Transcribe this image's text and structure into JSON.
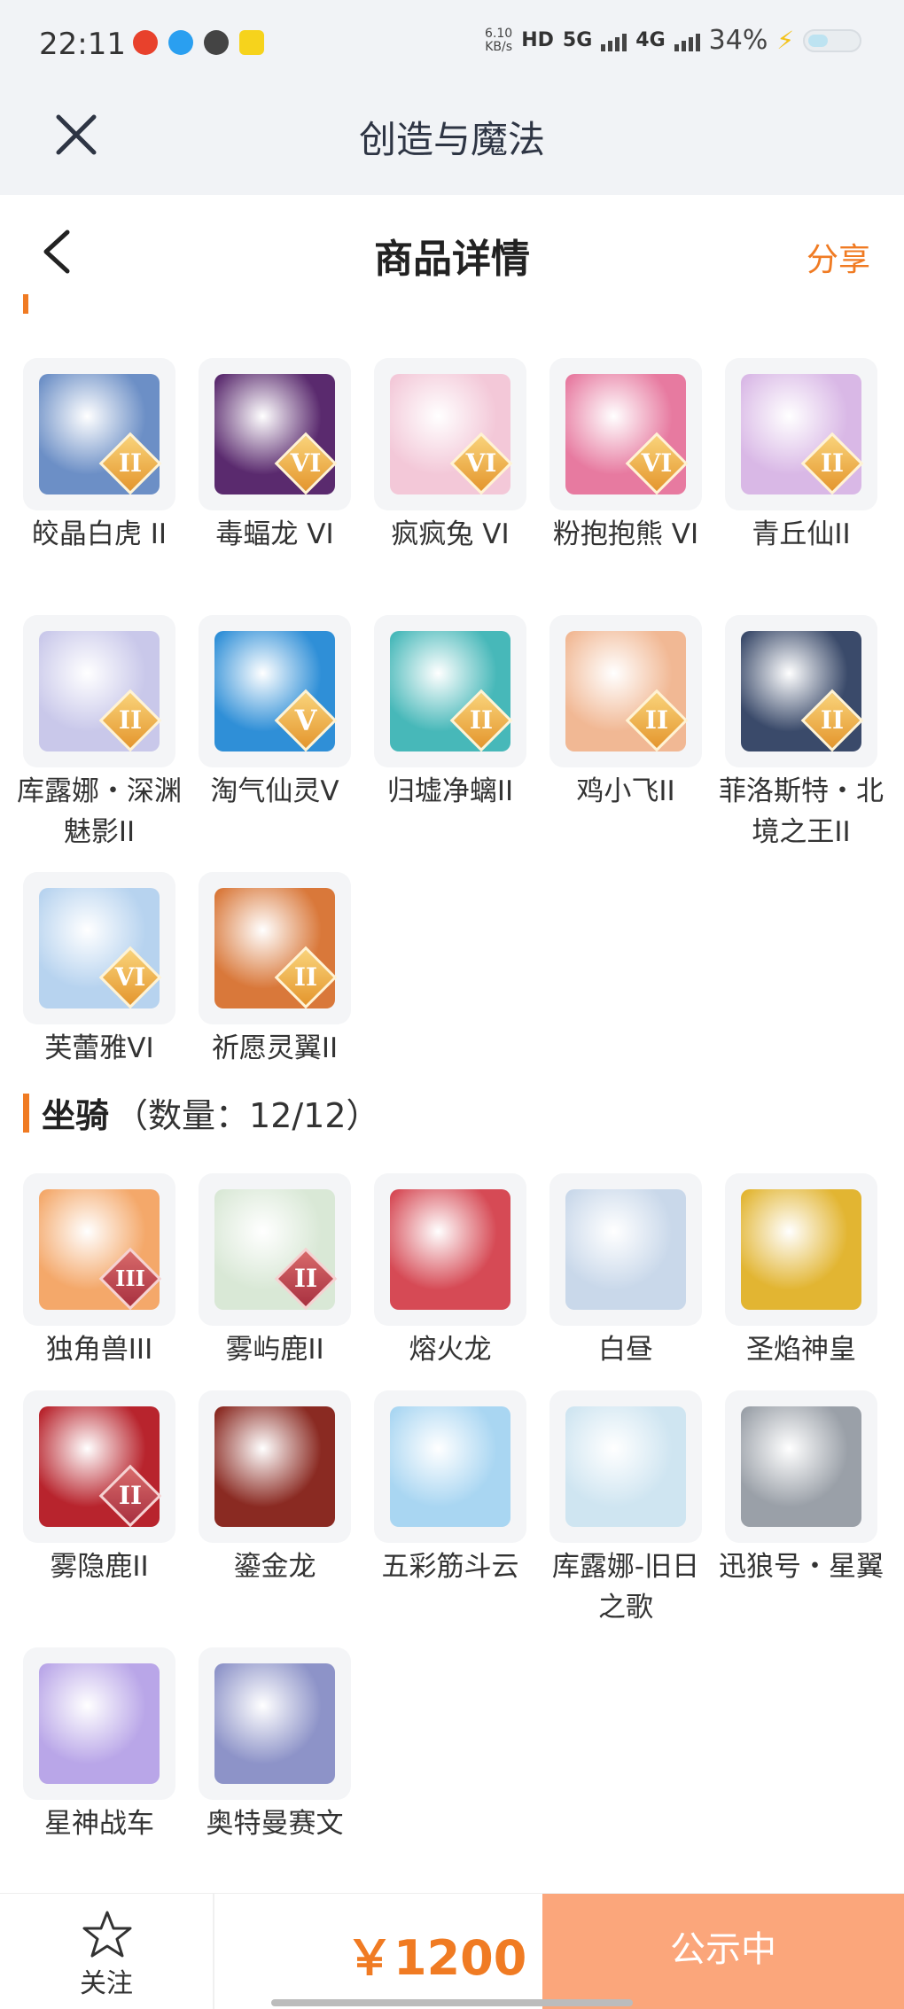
{
  "status_bar": {
    "time": "22:11",
    "net_speed_value": "6.10",
    "net_speed_unit": "KB/s",
    "hd": "HD",
    "sim1": "5G",
    "sim2": "4G",
    "battery": "34%"
  },
  "app_header": {
    "title": "创造与魔法"
  },
  "page_header": {
    "title": "商品详情",
    "share_label": "分享"
  },
  "pets_section": {
    "items": [
      {
        "name": "皎晶白虎 II",
        "rank": "II",
        "color": "#6c8fc6"
      },
      {
        "name": "毒蝠龙 VI",
        "rank": "VI",
        "color": "#5a2a6e"
      },
      {
        "name": "疯疯兔 VI",
        "rank": "VI",
        "color": "#f3c8d8"
      },
      {
        "name": "粉抱抱熊 VI",
        "rank": "VI",
        "color": "#e77aa0"
      },
      {
        "name": "青丘仙II",
        "rank": "II",
        "color": "#d9b8e6"
      },
      {
        "name": "库露娜・深渊魅影II",
        "rank": "II",
        "color": "#c9c8ea"
      },
      {
        "name": "淘气仙灵V",
        "rank": "V",
        "color": "#2f8fd7"
      },
      {
        "name": "归墟净螭II",
        "rank": "II",
        "color": "#47b8b9"
      },
      {
        "name": "鸡小飞II",
        "rank": "II",
        "color": "#f1b894"
      },
      {
        "name": "菲洛斯特・北境之王II",
        "rank": "II",
        "color": "#3a4a6a"
      },
      {
        "name": "芙蕾雅VI",
        "rank": "VI",
        "color": "#b7d3ef"
      },
      {
        "name": "祈愿灵翼II",
        "rank": "II",
        "color": "#d9783a"
      }
    ]
  },
  "mounts_section": {
    "name": "坐骑",
    "count": "（数量：12/12）",
    "items": [
      {
        "name": "独角兽III",
        "rank": "III",
        "rank_style": "red",
        "color": "#f4a86a"
      },
      {
        "name": "雾屿鹿II",
        "rank": "II",
        "rank_style": "red",
        "color": "#d9e8d6"
      },
      {
        "name": "熔火龙",
        "rank": "",
        "color": "#d64a55"
      },
      {
        "name": "白昼",
        "rank": "",
        "color": "#c9d8ea"
      },
      {
        "name": "圣焰神皇",
        "rank": "",
        "color": "#e2b532"
      },
      {
        "name": "雾隐鹿II",
        "rank": "II",
        "rank_style": "red",
        "color": "#b8242d"
      },
      {
        "name": "鎏金龙",
        "rank": "",
        "color": "#8a2a22"
      },
      {
        "name": "五彩筋斗云",
        "rank": "",
        "color": "#a9d6f2"
      },
      {
        "name": "库露娜-旧日之歌",
        "rank": "",
        "color": "#cfe5f1"
      },
      {
        "name": "迅狼号・星翼",
        "rank": "",
        "color": "#9aa0a8"
      },
      {
        "name": "星神战车",
        "rank": "",
        "color": "#b9a6e8"
      },
      {
        "name": "奥特曼赛文",
        "rank": "",
        "color": "#8d93c8"
      }
    ]
  },
  "bottom_bar": {
    "follow_label": "关注",
    "price": "￥1200",
    "status_label": "公示中"
  },
  "colors": {
    "accent": "#f07b23",
    "status_button": "#fba67b"
  }
}
